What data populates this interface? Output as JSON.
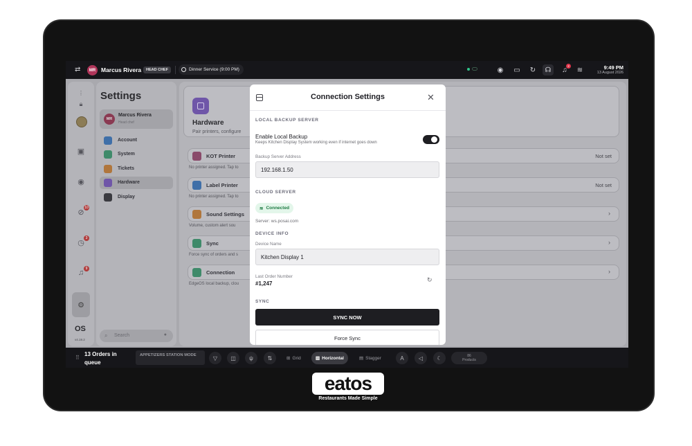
{
  "topbar": {
    "avatar_initials": "MR",
    "user_name": "Marcus Rivera",
    "role_badge": "HEAD CHEF",
    "service": "Dinner Service (9:00 PM)",
    "bell_count": "2",
    "time": "9:49 PM",
    "date": "13 August 2026"
  },
  "rail": {
    "badges": [
      "10",
      "3",
      "9"
    ],
    "os_label": "OS",
    "version": "v4.19.2"
  },
  "settings_panel": {
    "title": "Settings",
    "user": {
      "initials": "MR",
      "name": "Marcus Rivera",
      "role": "Head chef"
    },
    "items": [
      {
        "label": "Account",
        "color": "#3f6fa8"
      },
      {
        "label": "System",
        "color": "#3f8a6a"
      },
      {
        "label": "Tickets",
        "color": "#b0763c"
      },
      {
        "label": "Hardware",
        "color": "#6f56a8"
      },
      {
        "label": "Display",
        "color": "#3a3a40"
      }
    ],
    "search_placeholder": "Search"
  },
  "content": {
    "hardware_title": "Hardware",
    "hardware_sub": "Pair printers, configure",
    "rows": [
      {
        "label": "KOT Printer",
        "value": "Not set",
        "sub": "No printer assigned. Tap to",
        "color": "#8a4a6a"
      },
      {
        "label": "Label Printer",
        "value": "Not set",
        "sub": "No printer assigned. Tap to",
        "color": "#3f6fa8"
      },
      {
        "label": "Sound Settings",
        "value": "",
        "sub": "Volume, custom alert sou",
        "color": "#b0763c"
      },
      {
        "label": "Sync",
        "value": "",
        "sub": "Force sync of orders and s",
        "color": "#3f8a6a"
      },
      {
        "label": "Connection",
        "value": "",
        "sub": "EdgeOS local backup, clou",
        "color": "#3f8a6a"
      }
    ]
  },
  "bottombar": {
    "orders": "13 Orders in queue",
    "mode": "APPETIZERS STATION MODE",
    "layouts": [
      "Grid",
      "Horizontal",
      "Stagger"
    ],
    "products_count": "86",
    "products_label": "Products"
  },
  "modal": {
    "title": "Connection Settings",
    "local_section": "LOCAL BACKUP SERVER",
    "enable_label": "Enable Local Backup",
    "enable_help": "Keeps Kitchen Display System working even if internet goes down",
    "backup_enabled": true,
    "backup_address_label": "Backup Server Address",
    "backup_address": "192.168.1.50",
    "cloud_section": "CLOUD SERVER",
    "cloud_status": "Connected",
    "cloud_server": "Server: ws.posai.com",
    "device_section": "DEVICE INFO",
    "device_name_label": "Device Name",
    "device_name": "Kitchen Display 1",
    "last_order_label": "Last Order Number",
    "last_order": "#1,247",
    "sync_section": "SYNC",
    "sync_now": "SYNC NOW",
    "force_sync": "Force Sync"
  },
  "brand": {
    "wordmark": "eatos",
    "tagline": "Restaurants Made Simple"
  }
}
